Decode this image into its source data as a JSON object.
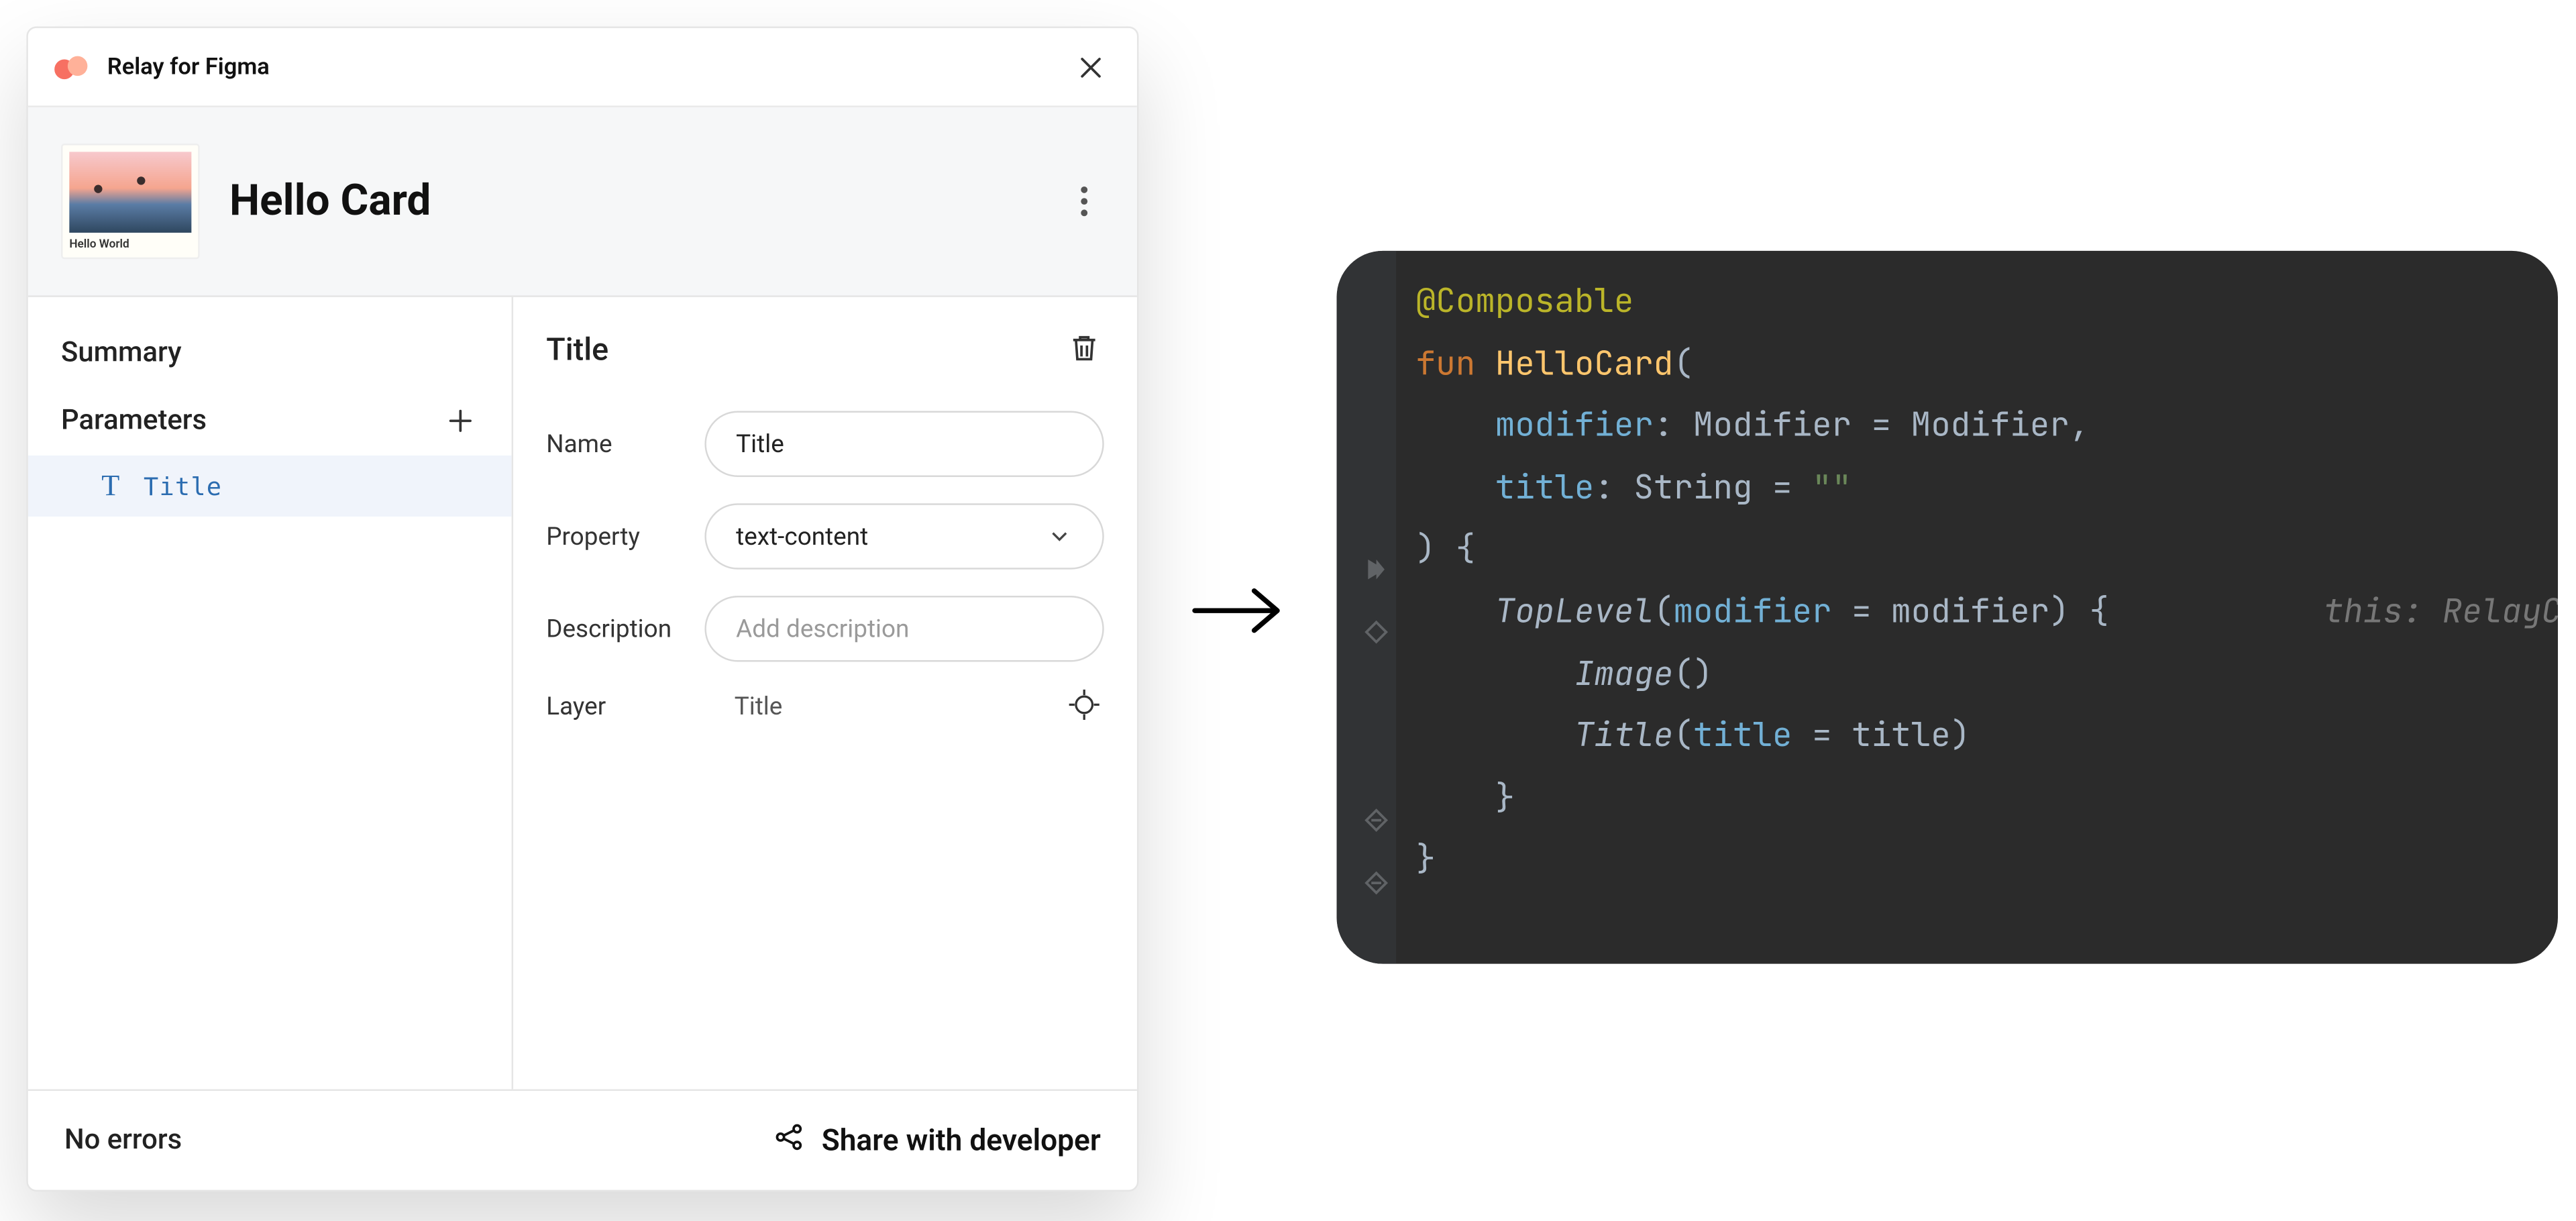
{
  "plugin": {
    "title": "Relay for Figma"
  },
  "component": {
    "name": "Hello Card",
    "thumb_caption": "Hello World"
  },
  "sidebar": {
    "summary_label": "Summary",
    "parameters_label": "Parameters",
    "parameters": [
      {
        "icon": "T",
        "name": "Title"
      }
    ]
  },
  "detail": {
    "title": "Title",
    "fields": {
      "name": {
        "label": "Name",
        "value": "Title"
      },
      "property": {
        "label": "Property",
        "value": "text-content"
      },
      "description": {
        "label": "Description",
        "placeholder": "Add description"
      },
      "layer": {
        "label": "Layer",
        "value": "Title"
      }
    }
  },
  "footer": {
    "status": "No errors",
    "share_label": "Share with developer"
  },
  "code": {
    "tokens": {
      "annotation": "@Composable",
      "fun_kw": "fun",
      "fn_name": "HelloCard",
      "modifier_param": "modifier",
      "modifier_type": "Modifier",
      "equals": "=",
      "modifier_default": "Modifier",
      "comma": ",",
      "title_param": "title",
      "string_type": "String",
      "empty_str": "\"\"",
      "lparen": "(",
      "rparen": ")",
      "lbrace": "{",
      "rbrace": "}",
      "toplevel_call": "TopLevel",
      "image_call": "Image",
      "title_call": "Title",
      "hint": "this: RelayCo"
    }
  }
}
